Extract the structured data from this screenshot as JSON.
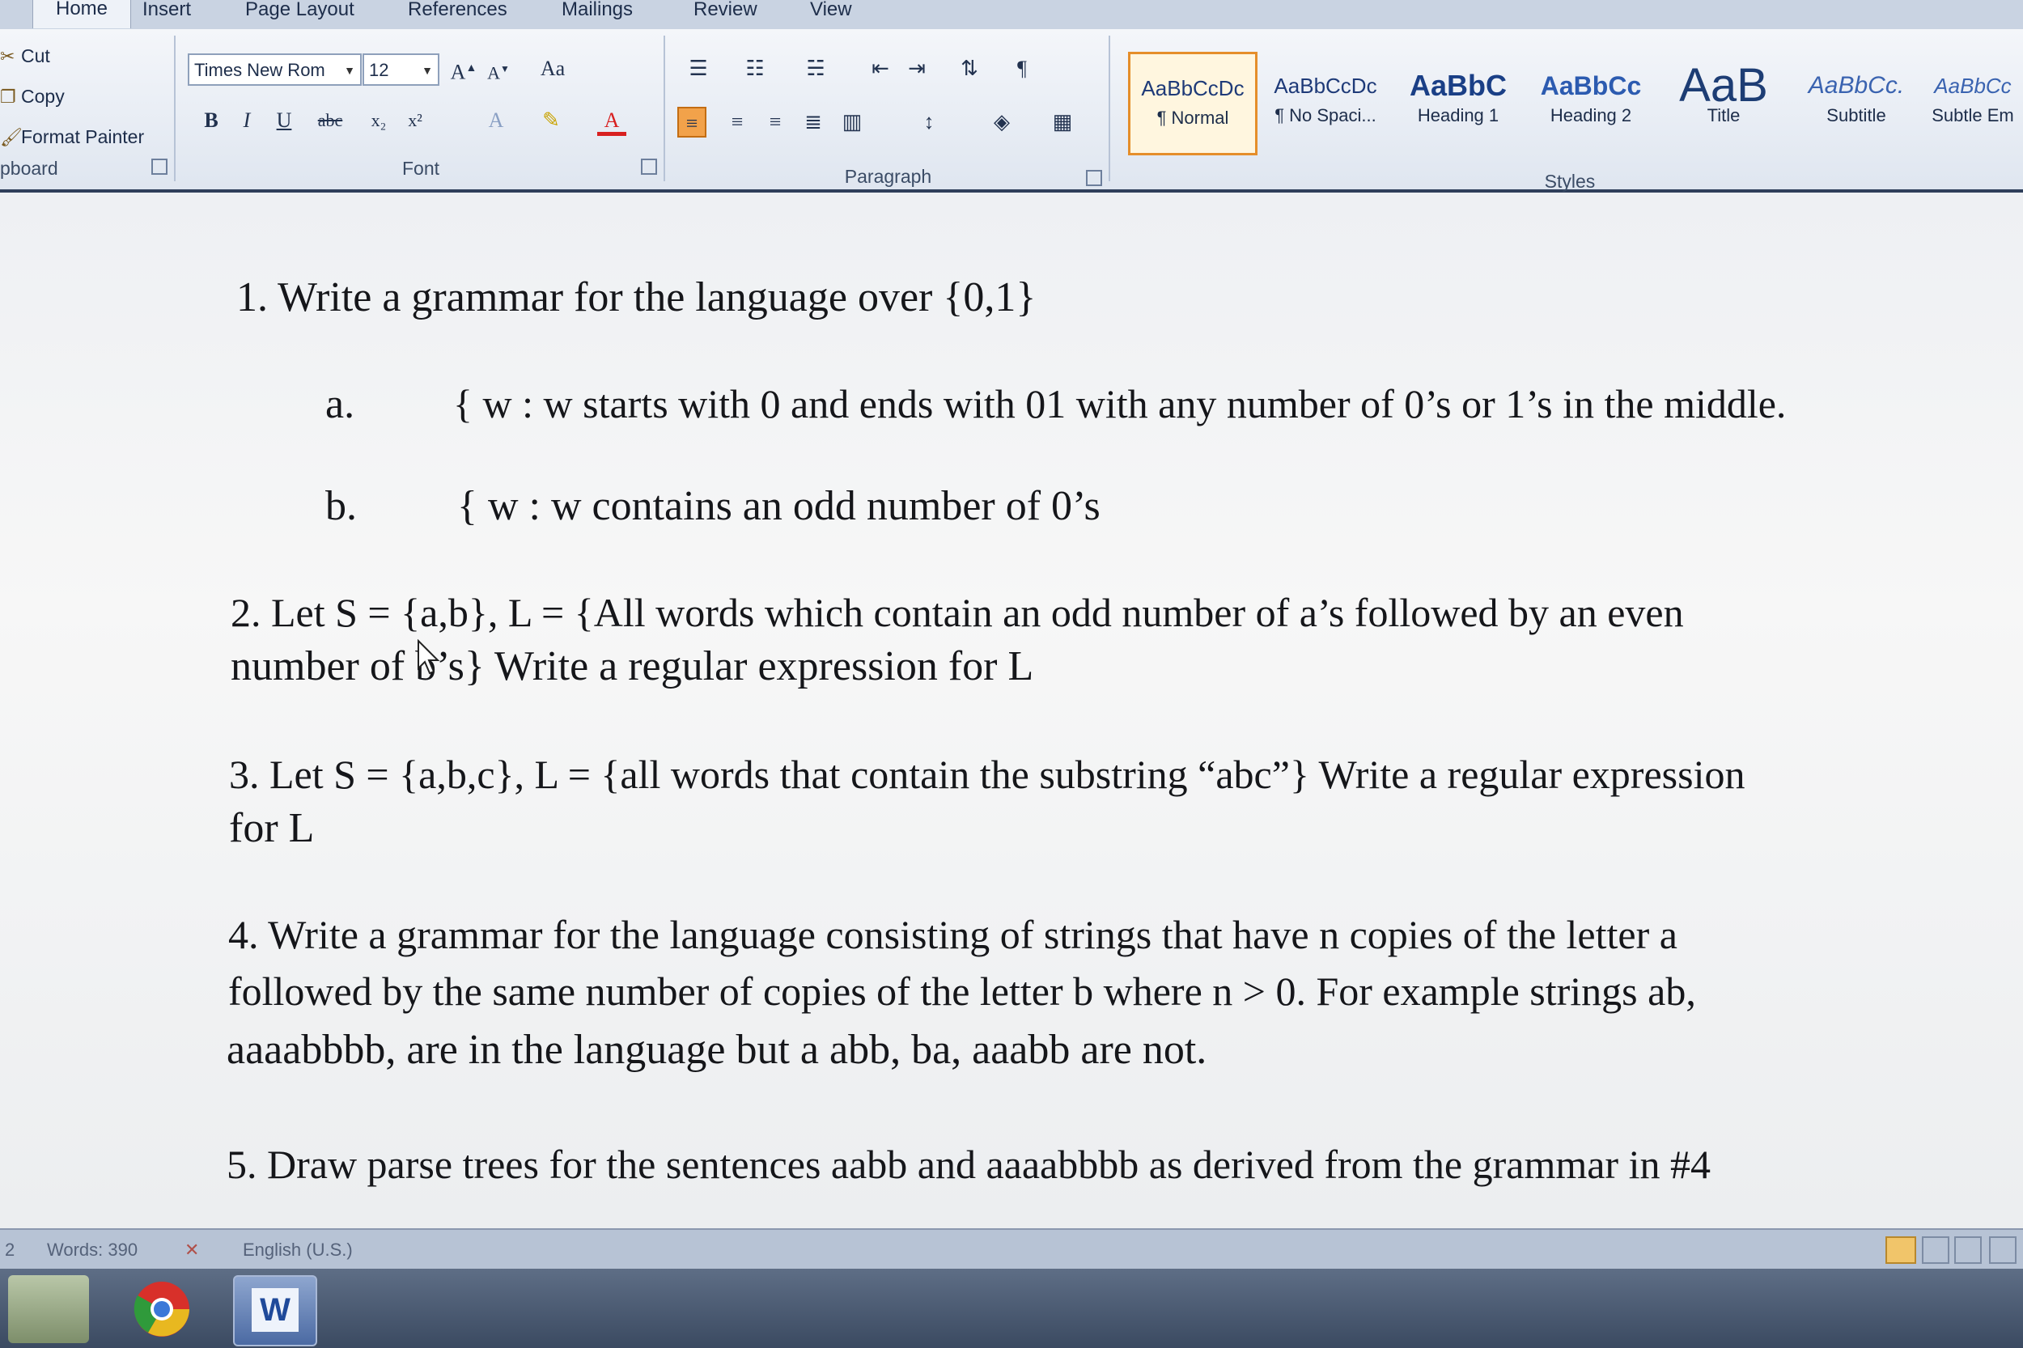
{
  "tabs": [
    "Home",
    "Insert",
    "Page Layout",
    "References",
    "Mailings",
    "Review",
    "View"
  ],
  "clipboard": {
    "items": [
      "Cut",
      "Copy",
      "Format Painter"
    ],
    "label": "pboard"
  },
  "font": {
    "name": "Times New Rom",
    "size": "12",
    "label": "Font",
    "buttons": [
      "B",
      "I",
      "U",
      "abc",
      "x₂",
      "x²",
      "A",
      "Aa"
    ]
  },
  "paragraph": {
    "label": "Paragraph"
  },
  "styles": {
    "label": "Styles",
    "items": [
      {
        "sample": "AaBbCcDc",
        "name": "¶ Normal"
      },
      {
        "sample": "AaBbCcDc",
        "name": "¶ No Spaci..."
      },
      {
        "sample": "AaBbC",
        "name": "Heading 1"
      },
      {
        "sample": "AaBbCc",
        "name": "Heading 2"
      },
      {
        "sample": "AaB",
        "name": "Title"
      },
      {
        "sample": "AaBbCc.",
        "name": "Subtitle"
      },
      {
        "sample": "AaBbCc",
        "name": "Subtle Em"
      }
    ]
  },
  "document": {
    "q1": "1.  Write a grammar  for the  language over {0,1}",
    "q1a_label": "a.",
    "q1a": "{ w : w starts with 0  and ends with 01 with any number of 0’s or 1’s in the middle.",
    "q1b_label": "b.",
    "q1b": "{ w : w contains an odd number of 0’s",
    "q2_l1": "2.  Let S = {a,b}, L = {All words which contain an odd number of a’s followed by an even",
    "q2_l2": "number of b’s}  Write a regular expression for L",
    "q3_l1": "3. Let S = {a,b,c}, L = {all words that contain the substring “abc”}  Write a regular expression",
    "q3_l2": "for L",
    "q4_l1": "4.  Write a grammar  for the language consisting of strings that have n copies of the letter a",
    "q4_l2": "followed by the same number of copies of the letter b where n > 0.  For example strings ab,",
    "q4_l3": "aaaabbbb, are in the language but a abb, ba, aaabb are not.",
    "q5": "5. Draw parse trees for the sentences aabb and aaaabbbb as derived from the grammar  in  #4"
  },
  "status": {
    "page": "2",
    "words": "Words: 390",
    "language": "English (U.S.)"
  }
}
